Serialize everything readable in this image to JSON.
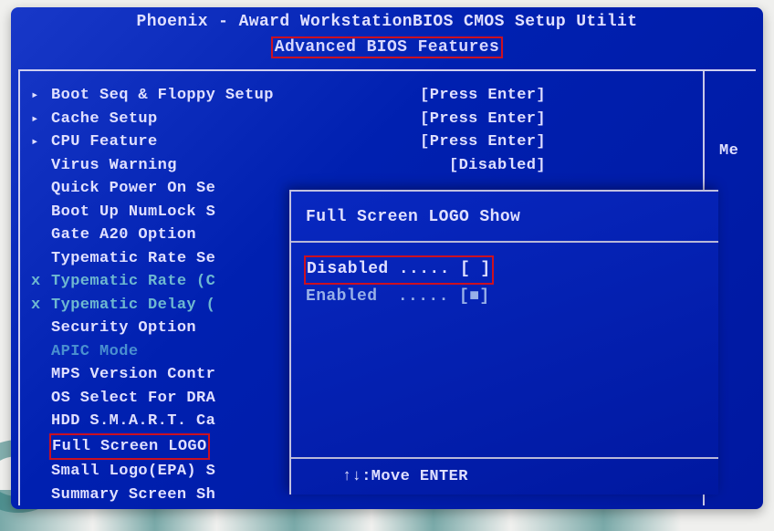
{
  "header": {
    "title": "Phoenix - Award WorkstationBIOS CMOS Setup Utilit",
    "subtitle": "Advanced BIOS Features"
  },
  "right_panel": {
    "text": "Me"
  },
  "menu": [
    {
      "ind": "tri",
      "label": "Boot Seq & Floppy Setup",
      "value": "[Press Enter]",
      "class": ""
    },
    {
      "ind": "tri",
      "label": "Cache Setup",
      "value": "[Press Enter]",
      "class": ""
    },
    {
      "ind": "tri",
      "label": "CPU Feature",
      "value": "[Press Enter]",
      "class": ""
    },
    {
      "ind": "",
      "label": "Virus Warning",
      "value": "[Disabled]",
      "class": ""
    },
    {
      "ind": "",
      "label": "Quick Power On Se",
      "value": "",
      "class": ""
    },
    {
      "ind": "",
      "label": "Boot Up NumLock S",
      "value": "",
      "class": ""
    },
    {
      "ind": "",
      "label": "Gate A20 Option",
      "value": "",
      "class": ""
    },
    {
      "ind": "",
      "label": "Typematic Rate Se",
      "value": "",
      "class": ""
    },
    {
      "ind": "x",
      "label": "Typematic Rate (C",
      "value": "",
      "class": "dim"
    },
    {
      "ind": "x",
      "label": "Typematic Delay (",
      "value": "",
      "class": "dim"
    },
    {
      "ind": "",
      "label": "Security Option",
      "value": "",
      "class": ""
    },
    {
      "ind": "",
      "label": "APIC Mode",
      "value": "",
      "class": "dim-solid"
    },
    {
      "ind": "",
      "label": "MPS Version Contr",
      "value": "",
      "class": ""
    },
    {
      "ind": "",
      "label": "OS Select For DRA",
      "value": "",
      "class": ""
    },
    {
      "ind": "",
      "label": "HDD S.M.A.R.T. Ca",
      "value": "",
      "class": ""
    },
    {
      "ind": "",
      "label": "Full Screen LOGO",
      "value": "",
      "class": "",
      "redbox": true
    },
    {
      "ind": "",
      "label": "Small Logo(EPA) S",
      "value": "",
      "class": ""
    },
    {
      "ind": "",
      "label": "Summary Screen Sh",
      "value": "",
      "class": ""
    }
  ],
  "popup": {
    "title": "Full Screen LOGO Show",
    "options": [
      {
        "text": "Disabled ..... [ ]",
        "redbox": true
      },
      {
        "text": "Enabled  ..... [■]",
        "dim": true
      }
    ],
    "footer": "↑↓:Move ENTER"
  }
}
